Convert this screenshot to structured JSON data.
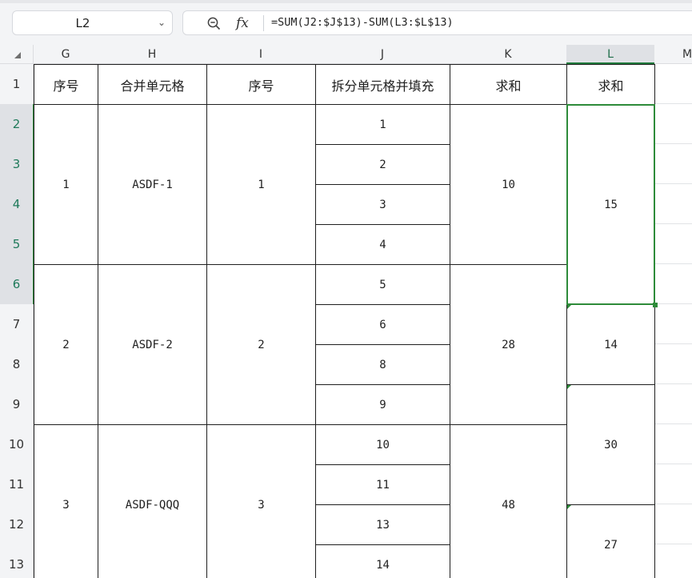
{
  "formula_bar": {
    "name_box": "L2",
    "fx_label": "fx",
    "formula": "=SUM(J2:$J$13)-SUM(L3:$L$13)"
  },
  "columns": [
    "G",
    "H",
    "I",
    "J",
    "K",
    "L",
    "M"
  ],
  "rows": [
    "1",
    "2",
    "3",
    "4",
    "5",
    "6",
    "7",
    "8",
    "9",
    "10",
    "11",
    "12",
    "13"
  ],
  "headers": {
    "g": "序号",
    "h": "合并单元格",
    "i": "序号",
    "j": "拆分单元格并填充",
    "k": "求和",
    "l": "求和"
  },
  "groups": [
    {
      "g": "1",
      "h": "ASDF-1",
      "i": "1",
      "k": "10"
    },
    {
      "g": "2",
      "h": "ASDF-2",
      "i": "2",
      "k": "28"
    },
    {
      "g": "3",
      "h": "ASDF-QQQ",
      "i": "3",
      "k": "48"
    }
  ],
  "col_j": [
    "1",
    "2",
    "3",
    "4",
    "5",
    "6",
    "8",
    "9",
    "10",
    "11",
    "13",
    "14"
  ],
  "col_l": [
    "15",
    "14",
    "30",
    "27"
  ],
  "selection": {
    "color": "#2e8b3a",
    "active_cell": "L2"
  }
}
